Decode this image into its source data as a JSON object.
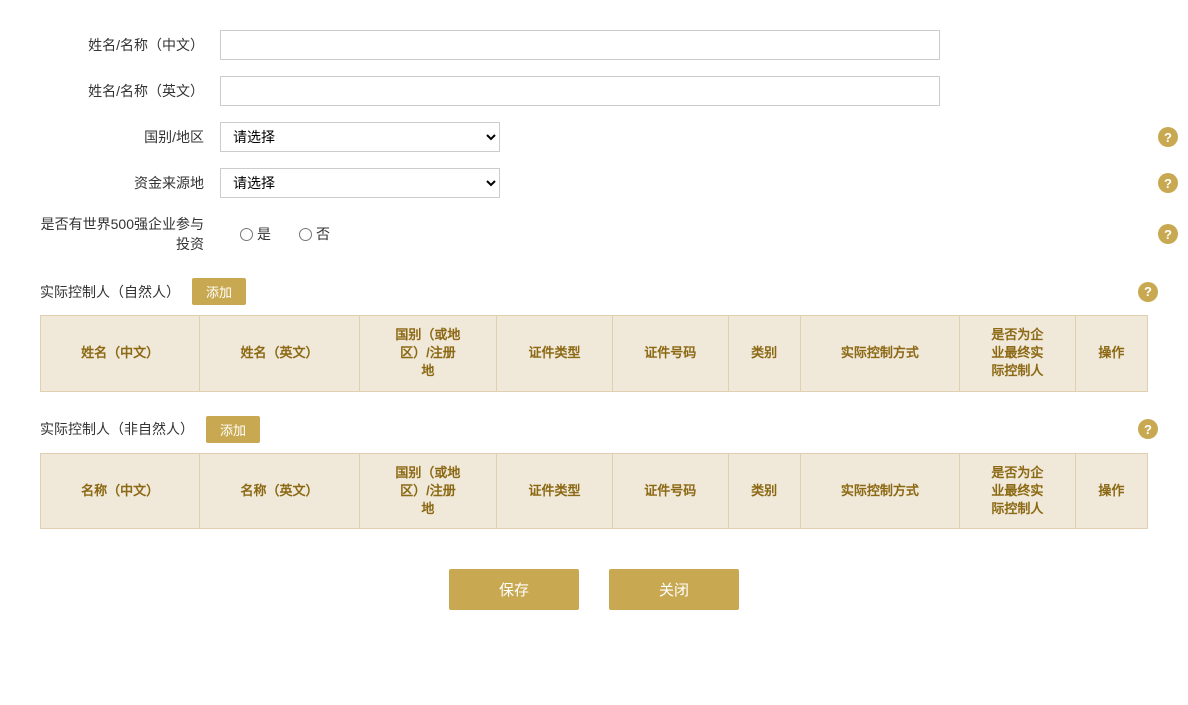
{
  "form": {
    "name_cn_label": "姓名/名称（中文）",
    "name_en_label": "姓名/名称（英文）",
    "country_label": "国别/地区",
    "fund_source_label": "资金来源地",
    "fortune500_label": "是否有世界500强企业参与投资",
    "country_placeholder": "请选择",
    "fund_source_placeholder": "请选择",
    "radio_yes": "是",
    "radio_no": "否",
    "name_cn_value": "",
    "name_en_value": ""
  },
  "section1": {
    "title": "实际控制人（自然人）",
    "add_label": "添加",
    "columns": [
      "姓名（中文）",
      "姓名（英文）",
      "国别（或地\n区）/注册\n地",
      "证件类型",
      "证件号码",
      "类别",
      "实际控制方式",
      "是否为企\n业最终实\n际控制人",
      "操作"
    ]
  },
  "section2": {
    "title": "实际控制人（非自然人）",
    "add_label": "添加",
    "columns": [
      "名称（中文）",
      "名称（英文）",
      "国别（或地\n区）/注册\n地",
      "证件类型",
      "证件号码",
      "类别",
      "实际控制方式",
      "是否为企\n业最终实\n际控制人",
      "操作"
    ]
  },
  "buttons": {
    "save": "保存",
    "close": "关闭"
  }
}
